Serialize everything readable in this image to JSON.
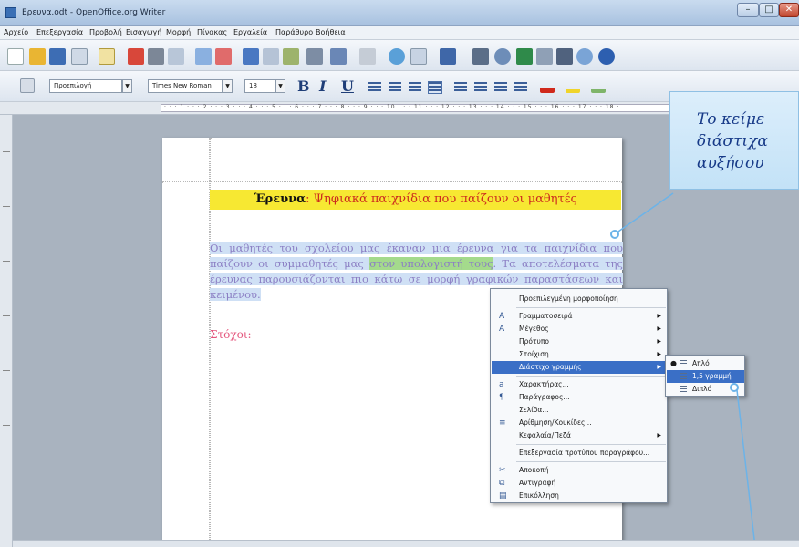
{
  "window": {
    "title": "Ερευνα.odt - OpenOffice.org Writer",
    "min": "–",
    "max": "□",
    "close": "✕"
  },
  "menubar": [
    "Αρχείο",
    "Επεξεργασία",
    "Προβολή",
    "Εισαγωγή",
    "Μορφή",
    "Πίνακας",
    "Εργαλεία",
    "Παράθυρο",
    "Βοήθεια"
  ],
  "toolbar2": {
    "style": "Προεπιλογή",
    "font": "Times New Roman",
    "size": "18",
    "bold": "B",
    "italic": "I",
    "underline": "U"
  },
  "ruler": {
    "marks": "· · · 1 · · · 2 · · · 3 · · · 4 · · · 5 · · · 6 · · · 7 · · · 8 · · · 9 · · · 10 · · · 11 · · · 12 · · · 13 · · · 14 · · · 15 · · · 16 · · · 17 · · · 18 ·"
  },
  "document": {
    "title_bold": "Έρευνα",
    "title_rest": ": Ψηφιακά παιχνίδια που παίζουν οι μαθητές",
    "para_before": "Οι μαθητές του σχολείου μας έκαναν μια έρευνα για τα παιχνίδια που παίζουν οι συμμαθητές μας ",
    "para_highlight": "στον υπολογιστή τους",
    "para_after": ". Τα αποτελέσματα της έρευνας παρουσιάζονται πιο κάτω σε μορφή γραφικών παραστάσεων και κειμένου.",
    "goals": "Στόχοι:"
  },
  "context_menu": {
    "items": [
      "Προεπιλεγμένη μορφοποίηση",
      "Γραμματοσειρά",
      "Μέγεθος",
      "Πρότυπο",
      "Στοίχιση",
      "Διάστιχο γραμμής",
      "Χαρακτήρας...",
      "Παράγραφος...",
      "Σελίδα...",
      "Αρίθμηση/Κουκίδες...",
      "Κεφαλαία/Πεζά",
      "Επεξεργασία προτύπου παραγράφου...",
      "Αποκοπή",
      "Αντιγραφή",
      "Επικόλληση"
    ]
  },
  "submenu": {
    "items": [
      "Απλό",
      "1,5 γραμμή",
      "Διπλό"
    ]
  },
  "callout": {
    "line1": "Το κείμε",
    "line2": "διάστιχα",
    "line3": "αυξήσου"
  },
  "colors": {
    "accent": "#3a6fc6",
    "title_bg": "#f7e832",
    "title_red": "#cc2a1e",
    "para_color": "#8b7fc4",
    "highlight": "#a4da8c",
    "goals": "#e4557c",
    "callout_text": "#173a88"
  }
}
